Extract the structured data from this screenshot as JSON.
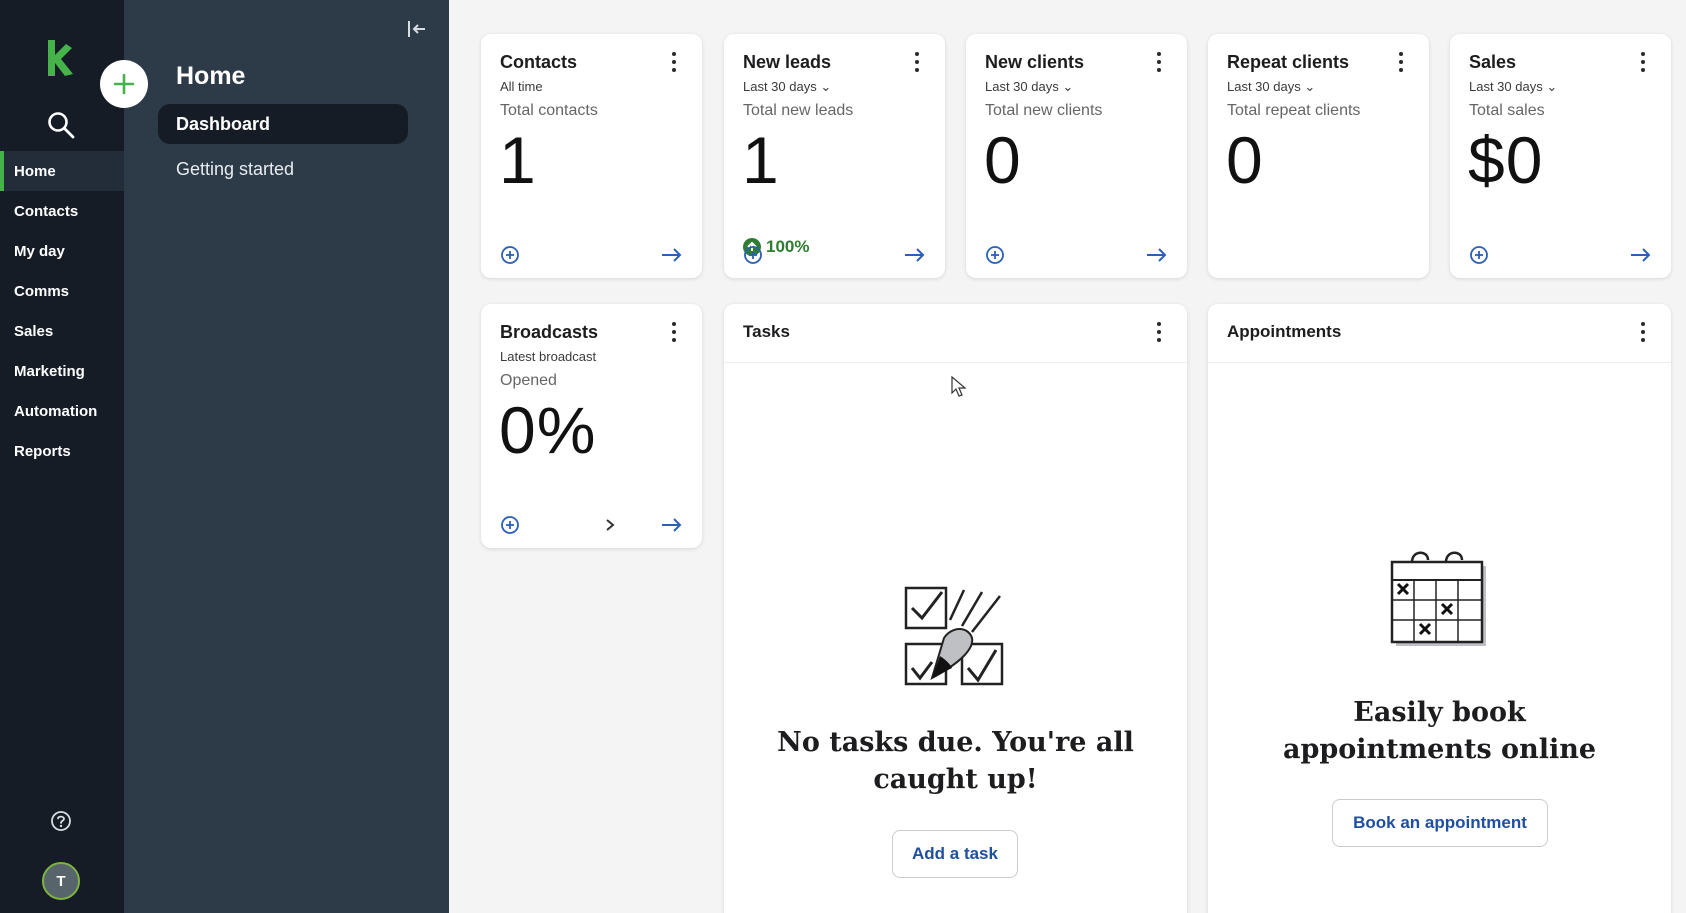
{
  "app": {
    "brand_color": "#46b34a"
  },
  "rail": {
    "items": [
      "Home",
      "Contacts",
      "My day",
      "Comms",
      "Sales",
      "Marketing",
      "Automation",
      "Reports"
    ],
    "active": "Home",
    "avatar_initial": "T"
  },
  "subnav": {
    "title": "Home",
    "items": [
      "Dashboard",
      "Getting started"
    ],
    "active": "Dashboard"
  },
  "cards": {
    "contacts": {
      "title": "Contacts",
      "range": "All time",
      "label": "Total contacts",
      "value": "1"
    },
    "leads": {
      "title": "New leads",
      "range": "Last 30 days",
      "label": "Total new leads",
      "value": "1",
      "change": "100%"
    },
    "clients": {
      "title": "New clients",
      "range": "Last 30 days",
      "label": "Total new clients",
      "value": "0"
    },
    "repeat": {
      "title": "Repeat clients",
      "range": "Last 30 days",
      "label": "Total repeat clients",
      "value": "0"
    },
    "sales": {
      "title": "Sales",
      "range": "Last 30 days",
      "label": "Total sales",
      "value": "$0"
    },
    "broadcasts": {
      "title": "Broadcasts",
      "range": "Latest broadcast",
      "label": "Opened",
      "value": "0%"
    }
  },
  "tasks": {
    "title": "Tasks",
    "empty_message": "No tasks due. You're all caught up!",
    "button": "Add a task"
  },
  "appointments": {
    "title": "Appointments",
    "empty_message": "Easily book appointments online",
    "button": "Book an appointment"
  }
}
